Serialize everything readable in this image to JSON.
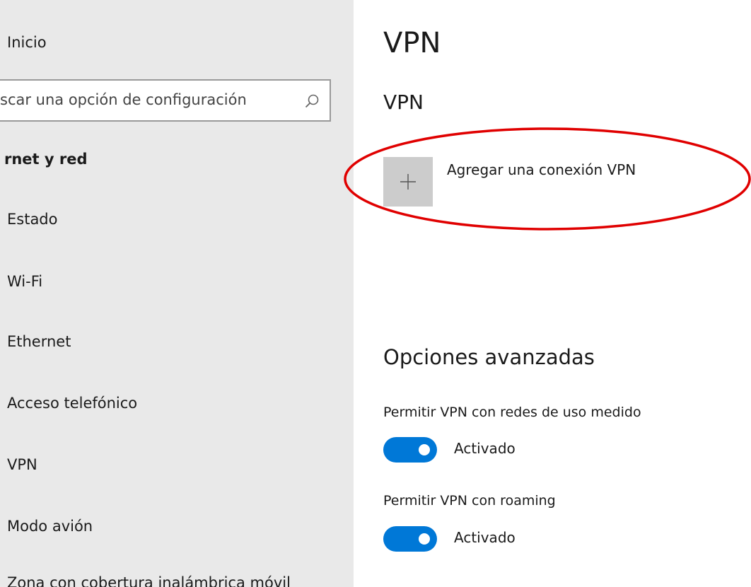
{
  "sidebar": {
    "home_label": "Inicio",
    "search_placeholder": "scar una opción de configuración",
    "section_label": "rnet y red",
    "items": [
      {
        "label": "Estado"
      },
      {
        "label": "Wi-Fi"
      },
      {
        "label": "Ethernet"
      },
      {
        "label": "Acceso telefónico"
      },
      {
        "label": "VPN"
      },
      {
        "label": "Modo avión"
      },
      {
        "label": "Zona con cobertura inalámbrica móvil"
      }
    ]
  },
  "main": {
    "page_title": "VPN",
    "section_title": "VPN",
    "add_connection_label": "Agregar una conexión VPN",
    "advanced": {
      "title": "Opciones avanzadas",
      "options": [
        {
          "label": "Permitir VPN con redes de uso medido",
          "state": "Activado",
          "on": true
        },
        {
          "label": "Permitir VPN con roaming",
          "state": "Activado",
          "on": true
        }
      ]
    }
  },
  "colors": {
    "accent": "#0078d7",
    "highlight_annotation": "#e00000",
    "sidebar_bg": "#e9e9e9"
  },
  "icons": {
    "search": "search-icon",
    "add": "plus-icon"
  }
}
